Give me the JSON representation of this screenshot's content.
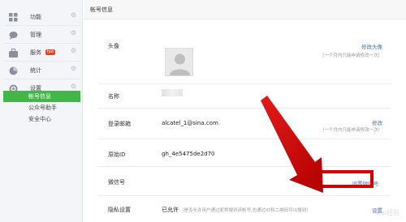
{
  "sidebar": {
    "items": [
      {
        "label": "功能"
      },
      {
        "label": "管理"
      },
      {
        "label": "服务",
        "badge": "hot"
      },
      {
        "label": "统计"
      },
      {
        "label": "设置"
      }
    ],
    "sub_items": [
      {
        "label": "帐号信息",
        "active": true
      },
      {
        "label": "公众号助手"
      },
      {
        "label": "安全中心"
      }
    ]
  },
  "main": {
    "title": "帐号信息",
    "rows": {
      "avatar": {
        "label": "头像",
        "link": "修改头像",
        "hint": "（一个月内只能申请修改一次）"
      },
      "name": {
        "label": "名称"
      },
      "email": {
        "label": "登录邮箱",
        "value": "alcatel_1@sina.com",
        "link": "修改",
        "hint": "（一个月内只能申请修改一次）"
      },
      "original_id": {
        "label": "原始ID",
        "value": "gh_4e5475de2d70"
      },
      "wechat_id": {
        "label": "微信号",
        "link": "设置微信号"
      },
      "privacy": {
        "label": "隐私设置",
        "value": "已允许",
        "note": "（是否允许用户通过昵称搜到该帐号,也通过ID和二维码可以搜到）",
        "link": "设置"
      }
    }
  },
  "watermark": "Bai经验",
  "colors": {
    "active_green": "#44b549",
    "link_blue": "#3f72b5",
    "annotation_red": "#d30000"
  }
}
